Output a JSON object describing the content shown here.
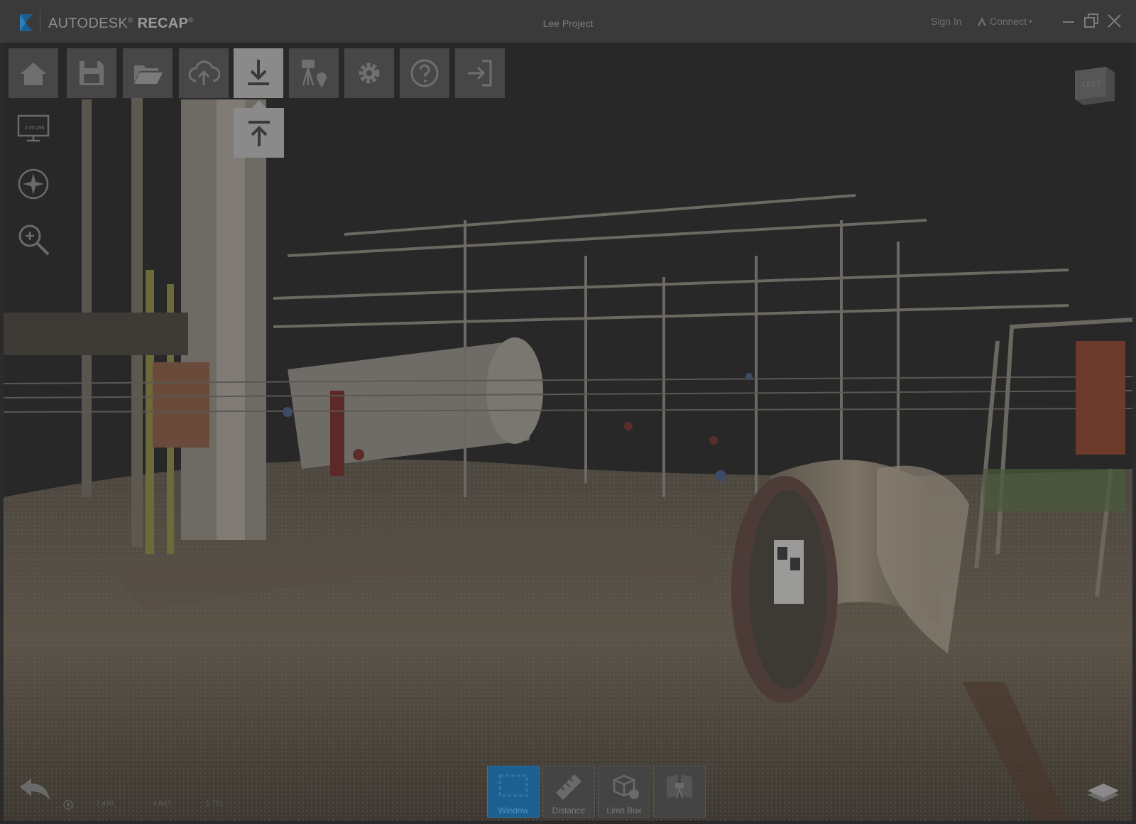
{
  "app": {
    "brand_left": "AUTODESK",
    "brand_reg": "®",
    "brand_right": "RECAP",
    "brand_tm": "®",
    "window_title": "Lee Project",
    "sign_in": "Sign In",
    "connect": "Connect",
    "connect_caret": "▾"
  },
  "toolbar": {
    "items": [
      {
        "name": "home",
        "icon": "home-icon"
      },
      {
        "name": "save",
        "icon": "save-icon"
      },
      {
        "name": "open",
        "icon": "folder-open-icon"
      },
      {
        "name": "upload",
        "icon": "cloud-upload-icon"
      },
      {
        "name": "import",
        "icon": "import-icon",
        "active": true
      },
      {
        "name": "scan-location",
        "icon": "scan-location-icon"
      },
      {
        "name": "settings",
        "icon": "gear-icon"
      },
      {
        "name": "help",
        "icon": "help-icon"
      },
      {
        "name": "exit",
        "icon": "exit-icon"
      }
    ],
    "flyout_item": {
      "name": "export",
      "icon": "export-icon"
    }
  },
  "left_nav": {
    "display_label": "2.00.256",
    "items": [
      "display-settings-icon",
      "compass-icon",
      "zoom-icon"
    ]
  },
  "viewcube": {
    "face": "LEFT"
  },
  "status": {
    "coord_x": "7.498",
    "coord_y": "4.847",
    "coord_z": "1.761"
  },
  "bottom_tools": [
    {
      "label": "Window",
      "icon": "window-select-icon",
      "active": true
    },
    {
      "label": "Distance",
      "icon": "ruler-icon",
      "active": false
    },
    {
      "label": "Limit Box",
      "icon": "limit-box-icon",
      "active": false
    },
    {
      "label": "",
      "icon": "scan-view-icon",
      "active": false
    }
  ],
  "colors": {
    "titlebar": "#3a3a3a",
    "toolbar_button": "#474747",
    "toolbar_active": "#8a8a8a",
    "selection_blue": "#1d5f8e",
    "logo_blue": "#1a5f8f"
  }
}
